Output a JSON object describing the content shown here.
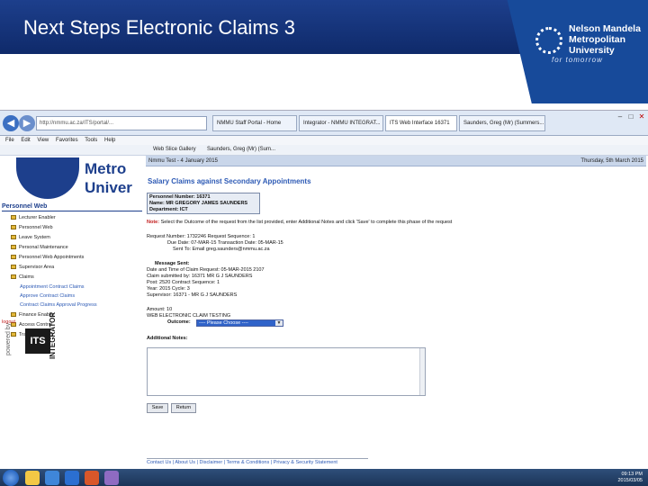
{
  "slide": {
    "title": "Next Steps Electronic Claims 3",
    "logo_lines": [
      "Nelson Mandela",
      "Metropolitan",
      "University"
    ],
    "logo_tagline": "for tomorrow"
  },
  "browser": {
    "address": "http://nmmu.ac.za/ITS/portal/...",
    "tabs": [
      "NMMU Staff Portal - Home",
      "Integrator - NMMU INTEGRAT...",
      "ITS Web Interface 16371",
      "Saunders, Greg (Mr) (Summers..."
    ],
    "menu": [
      "File",
      "Edit",
      "View",
      "Favorites",
      "Tools",
      "Help"
    ],
    "favorites": [
      "Web Slice Gallery",
      "Saunders, Greg (Mr) (Sum..."
    ]
  },
  "sidebar": {
    "brand_lines": [
      "Metro",
      "Univer"
    ],
    "heading": "Personnel Web",
    "items": [
      {
        "label": "Lecturer Enabler",
        "link": false
      },
      {
        "label": "Personnel Web",
        "link": false
      },
      {
        "label": "Leave System",
        "link": false
      },
      {
        "label": "Personal Maintenance",
        "link": false
      },
      {
        "label": "Personnel Web Appointments",
        "link": false
      },
      {
        "label": "Supervisor Area",
        "link": false
      },
      {
        "label": "Claims",
        "link": false
      },
      {
        "label": "Appointment Contract Claims",
        "link": true
      },
      {
        "label": "Approve Contract Claims",
        "link": true
      },
      {
        "label": "Contract Claims Approval Progress",
        "link": true
      },
      {
        "label": "Finance Enabler",
        "link": false
      },
      {
        "label": "Access Control",
        "link": false
      },
      {
        "label": "Travel Request",
        "link": false
      }
    ],
    "logout": "logout",
    "powered_by": "powered by",
    "its": "ITS",
    "integrator": "INTEGRATOR"
  },
  "main": {
    "strip_left": "Nmmu Test - 4 January 2015",
    "strip_right": "Thursday, 5th March 2015",
    "title": "Salary Claims against Secondary Appointments",
    "person": {
      "number": "Personnel Number: 16371",
      "name": "Name: MR GREGORY JAMES SAUNDERS",
      "department": "Department: ICT"
    },
    "note_label": "Note:",
    "note_text": "Select the Outcome of the request from the list provided, enter Additional Notes and click 'Save' to complete this phase of the request",
    "request_line": "Request Number: 1732246     Request Sequence: 1",
    "due_line": "Due Date: 07-MAR-15     Transaction Date: 05-MAR-15",
    "sent_line": "Sent To: Email     greg.saunders@nmmu.ac.za",
    "message_label": "Message Sent:",
    "message_lines": [
      "Date and Time of Claim Request: 05-MAR-2015 2107",
      "Claim submitted by: 16371 MR G J SAUNDERS",
      "Post: 2520     Contract Sequence: 1",
      "Year: 2015 Cycle: 3",
      "Supervisor: 16371 - MR G J SAUNDERS"
    ],
    "amount_line": "Amount: 10",
    "web_claim": "WEB ELECTRONIC CLAIM TESTING",
    "outcome_label": "Outcome:",
    "outcome_value": "---- Please Choose ----",
    "additional_notes_label": "Additional Notes:",
    "save_label": "Save",
    "return_label": "Return",
    "footer": "Contact Us | About Us | Disclaimer | Terms & Conditions | Privacy & Security Statement"
  },
  "taskbar": {
    "time": "09:13 PM",
    "date": "2015/03/05"
  }
}
